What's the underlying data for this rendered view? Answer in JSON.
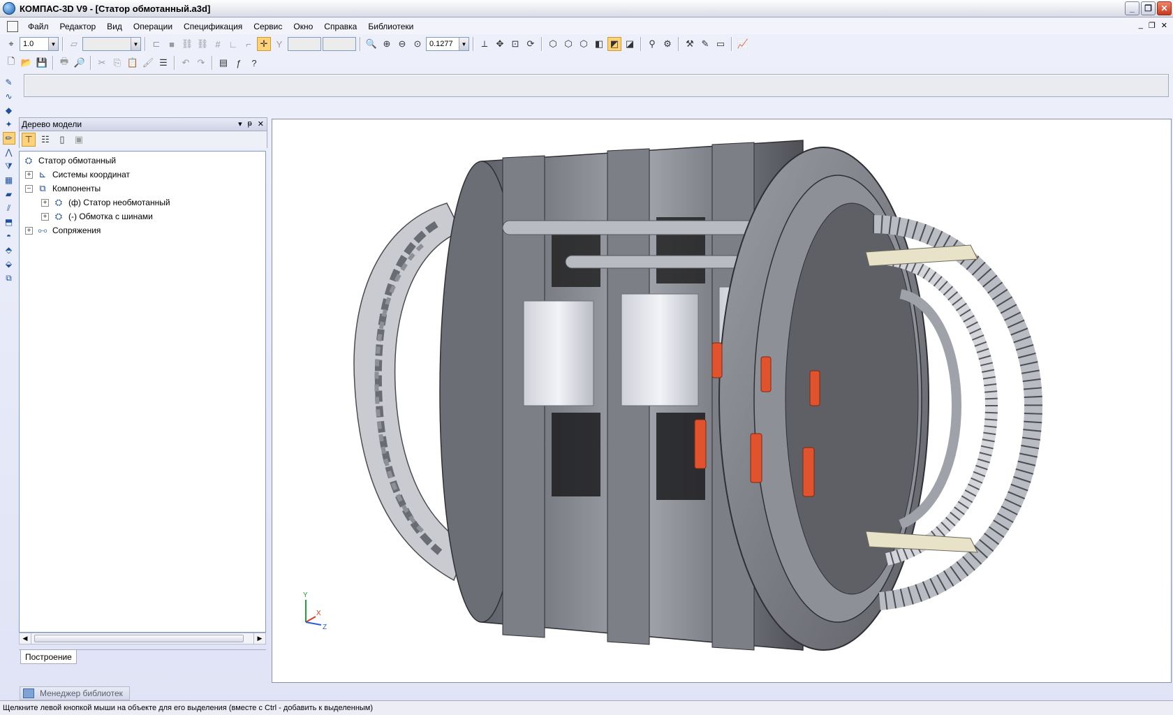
{
  "window": {
    "title": "КОМПАС-3D V9 - [Статор обмотанный.a3d]",
    "minimize_glyph": "_",
    "restore_glyph": "❐",
    "close_glyph": "✕"
  },
  "menu": {
    "items": [
      "Файл",
      "Редактор",
      "Вид",
      "Операции",
      "Спецификация",
      "Сервис",
      "Окно",
      "Справка",
      "Библиотеки"
    ],
    "doc_controls": [
      "_",
      "❐",
      "✕"
    ]
  },
  "toolbar": {
    "step_value": "1.0",
    "zoom_value": "0.1277"
  },
  "model_tree": {
    "header": "Дерево модели",
    "header_controls": [
      "▾",
      "ᵽ",
      "✕"
    ],
    "nodes": [
      {
        "label": "Статор обмотанный",
        "level": 0,
        "expander": ""
      },
      {
        "label": "Системы координат",
        "level": 1,
        "expander": "+"
      },
      {
        "label": "Компоненты",
        "level": 1,
        "expander": "−"
      },
      {
        "label": "(ф) Статор необмотанный",
        "level": 2,
        "expander": "+"
      },
      {
        "label": "(-) Обмотка с шинами",
        "level": 2,
        "expander": "+"
      },
      {
        "label": "Сопряжения",
        "level": 1,
        "expander": "+"
      }
    ],
    "tab": "Построение"
  },
  "library_manager": {
    "label": "Менеджер библиотек"
  },
  "axes": {
    "y": "Y",
    "x": "X",
    "z": "Z"
  },
  "statusbar": {
    "text": "Щелкните левой кнопкой мыши на объекте для его выделения (вместе с Ctrl - добавить к выделенным)"
  },
  "colors": {
    "accent": "#ffd27a",
    "clamp": "#e0532c",
    "steel": "#8a8d94"
  },
  "icons": {
    "app": "kompas-logo-icon",
    "tree_root": "assembly-icon",
    "coord": "coordinate-system-icon",
    "components": "components-icon",
    "part": "part-icon",
    "mates": "mates-icon"
  }
}
